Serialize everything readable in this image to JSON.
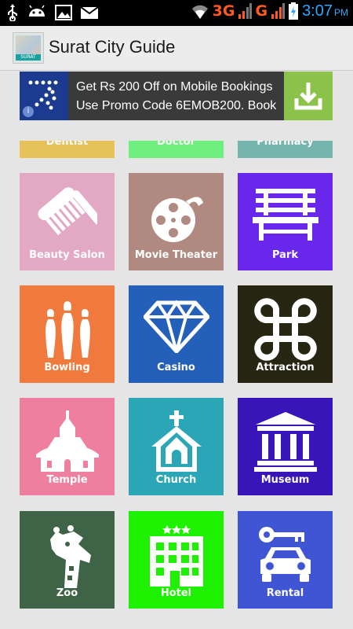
{
  "status_bar": {
    "network_left": "3G",
    "network_right": "G",
    "time": "3:07",
    "ampm": "PM"
  },
  "app": {
    "title": "Surat City Guide",
    "logo_caption": "SURAT"
  },
  "ad": {
    "line1": "Get Rs 200 Off on Mobile Bookings",
    "line2": "Use Promo Code 6EMOB200. Book",
    "info": "i"
  },
  "partial_tiles": [
    {
      "label": "Dentist",
      "color": "#e7c25a"
    },
    {
      "label": "Doctor",
      "color": "#6ff07e"
    },
    {
      "label": "Pharmacy",
      "color": "#74b6ae"
    }
  ],
  "tiles": [
    {
      "label": "Beauty Salon",
      "color": "#e3a8c4",
      "icon": "comb-icon"
    },
    {
      "label": "Movie Theater",
      "color": "#b08a80",
      "icon": "film-reel-icon"
    },
    {
      "label": "Park",
      "color": "#6a27ec",
      "icon": "bench-icon"
    },
    {
      "label": "Bowling",
      "color": "#f07a3e",
      "icon": "bowling-pins-icon"
    },
    {
      "label": "Casino",
      "color": "#2460ba",
      "icon": "diamond-icon"
    },
    {
      "label": "Attraction",
      "color": "#262613",
      "icon": "command-icon"
    },
    {
      "label": "Temple",
      "color": "#ef7f9f",
      "icon": "temple-icon"
    },
    {
      "label": "Church",
      "color": "#2aa6b7",
      "icon": "church-icon"
    },
    {
      "label": "Museum",
      "color": "#3815b8",
      "icon": "museum-icon"
    },
    {
      "label": "Zoo",
      "color": "#3e6346",
      "icon": "giraffe-icon"
    },
    {
      "label": "Hotel",
      "color": "#1ef100",
      "icon": "hotel-icon"
    },
    {
      "label": "Rental",
      "color": "#3f55d4",
      "icon": "car-rental-icon"
    }
  ]
}
